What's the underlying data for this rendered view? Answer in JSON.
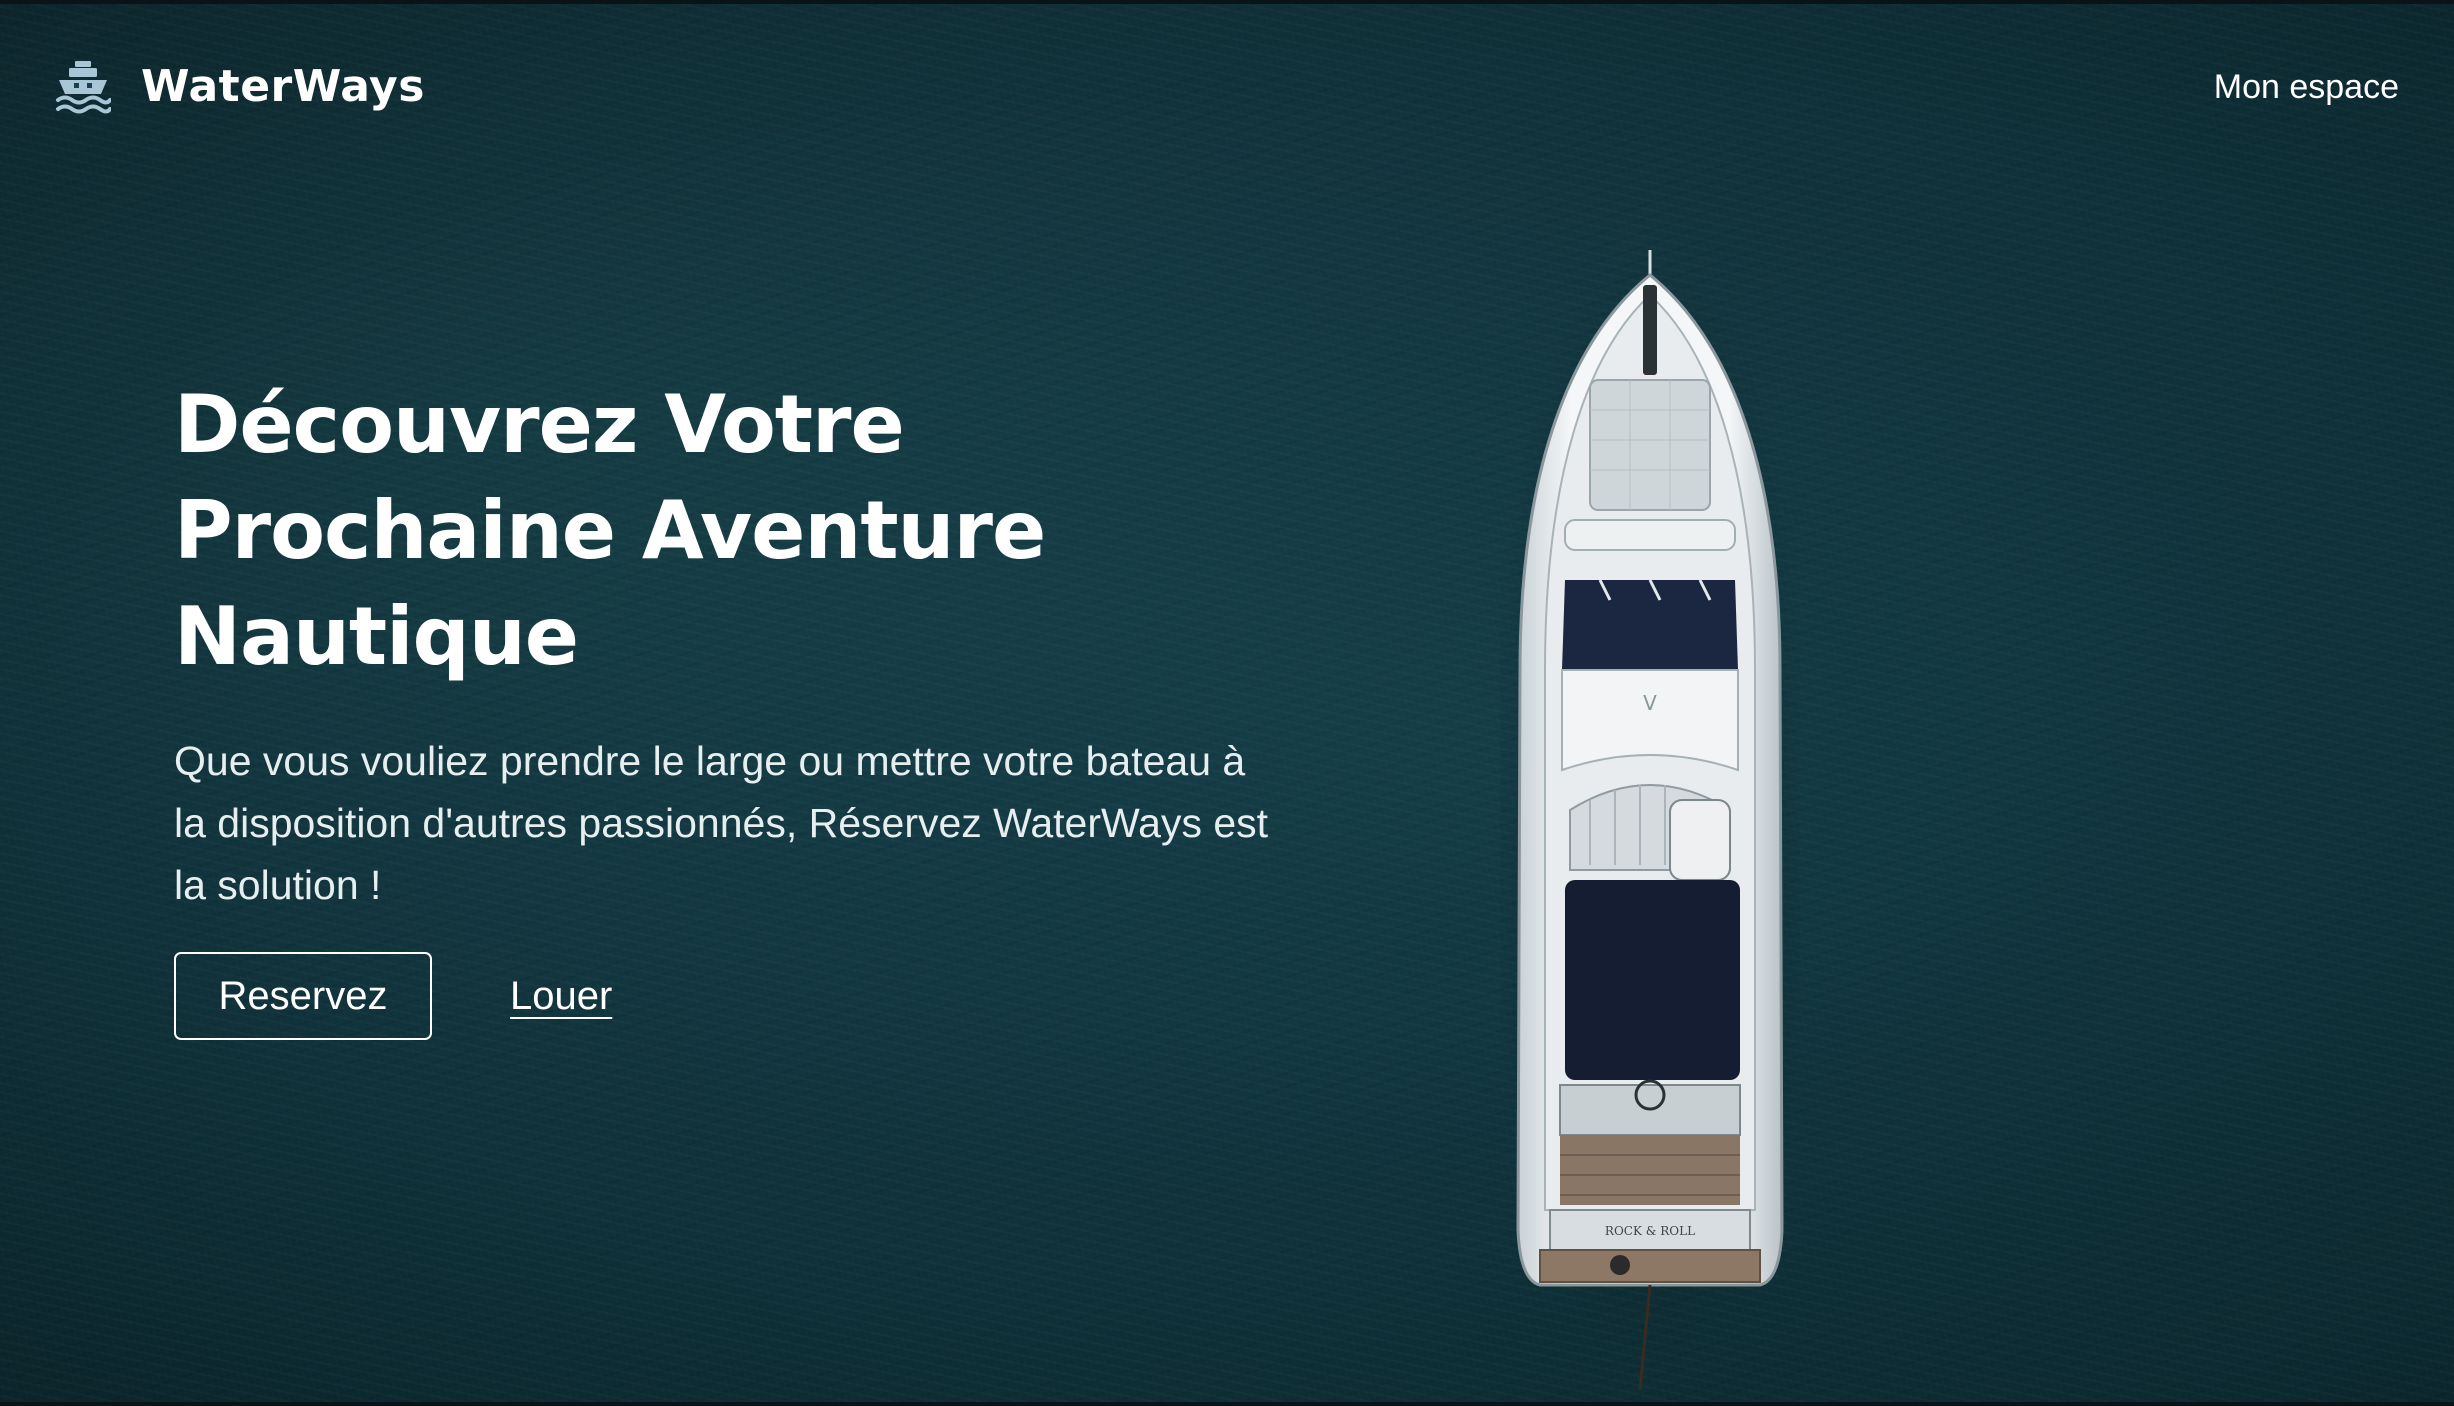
{
  "header": {
    "brand_name": "WaterWays",
    "brand_icon": "ship-icon",
    "nav_link": "Mon espace"
  },
  "hero": {
    "headline_lines": [
      "Découvrez Votre",
      "Prochaine Aventure",
      "Nautique"
    ],
    "subtitle": "Que vous vouliez prendre le large ou mettre votre bateau à la disposition d'autres passionnés, Réservez WaterWays est la solution !",
    "primary_button": "Reservez",
    "secondary_link": "Louer",
    "boat_name": "ROCK & ROLL"
  },
  "colors": {
    "sea": "#16404a",
    "text": "#ffffff",
    "icon": "#a9c6d6"
  }
}
